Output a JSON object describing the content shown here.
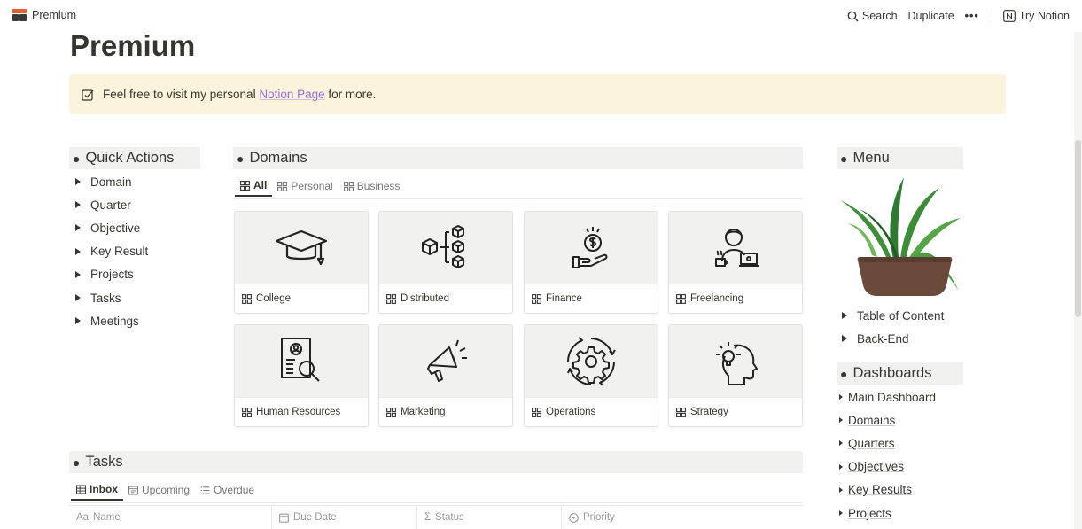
{
  "topbar": {
    "breadcrumb": "Premium",
    "search": "Search",
    "duplicate": "Duplicate",
    "more": "•••",
    "try_notion": "Try Notion"
  },
  "page": {
    "title": "Premium"
  },
  "callout": {
    "prefix": "Feel free to visit my personal ",
    "link": "Notion Page",
    "suffix": " for more."
  },
  "quick_actions": {
    "header": "Quick Actions",
    "items": [
      "Domain",
      "Quarter",
      "Objective",
      "Key Result",
      "Projects",
      "Tasks",
      "Meetings"
    ]
  },
  "domains": {
    "header": "Domains",
    "tabs": [
      "All",
      "Personal",
      "Business"
    ],
    "cards": [
      "College",
      "Distributed",
      "Finance",
      "Freelancing",
      "Human Resources",
      "Marketing",
      "Operations",
      "Strategy"
    ]
  },
  "menu": {
    "header": "Menu",
    "items": [
      "Table of Content",
      "Back-End"
    ]
  },
  "dashboards": {
    "header": "Dashboards",
    "items": [
      "Main Dashboard",
      "Domains",
      "Quarters",
      "Objectives",
      "Key Results",
      "Projects"
    ]
  },
  "tasks": {
    "header": "Tasks",
    "tabs": [
      "Inbox",
      "Upcoming",
      "Overdue"
    ],
    "columns": [
      "Name",
      "Due Date",
      "Status",
      "Priority"
    ],
    "column_prefixes": [
      "Aa",
      "",
      "Σ",
      ""
    ]
  },
  "colors": {
    "callout_bg": "#fbf3db",
    "link": "#9a6dd7",
    "section_bg": "#f1f1ef"
  }
}
